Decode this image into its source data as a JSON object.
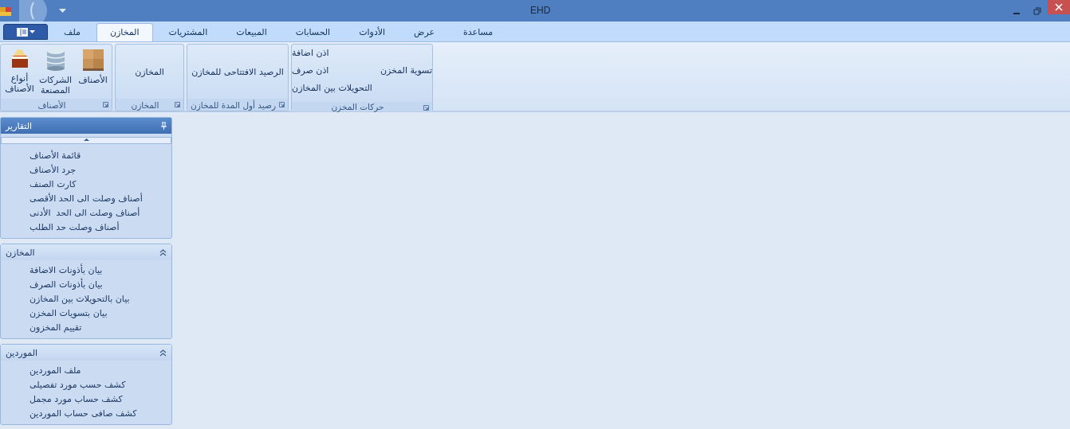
{
  "window": {
    "title": "EHD"
  },
  "tabs": [
    {
      "label": "مساعدة",
      "selected": false
    },
    {
      "label": "عرض",
      "selected": false
    },
    {
      "label": "الأدوات",
      "selected": false
    },
    {
      "label": "الحسابات",
      "selected": false
    },
    {
      "label": "المبيعات",
      "selected": false
    },
    {
      "label": "المشتريات",
      "selected": false
    },
    {
      "label": "المخازن",
      "selected": true
    },
    {
      "label": "ملف",
      "selected": false
    }
  ],
  "ribbon": {
    "groups": [
      {
        "kind": "columns",
        "label": "حركات المخزن",
        "columns": [
          [
            "تسوية المخزن"
          ],
          [
            "اذن اضافة",
            "اذن صرف",
            "التحويلات بين المخازن"
          ]
        ]
      },
      {
        "kind": "text",
        "label": "رصيد أول المدة للمخازن",
        "buttons": [
          "الرصيد الافتتاحى للمخازن"
        ]
      },
      {
        "kind": "text",
        "label": "المخازن",
        "buttons": [
          "المخازن"
        ]
      },
      {
        "kind": "icons",
        "label": "الأصناف",
        "buttons": [
          "الأصناف",
          "الشركات\nالمصنعة",
          "أنواع\nالأصناف"
        ]
      }
    ]
  },
  "sidebar": {
    "panels": [
      {
        "title": "التقارير",
        "expanded": true,
        "kind": "pinned",
        "items": [
          "قائمة الأصناف",
          "جرد الأصناف",
          "كارت الصنف",
          "أصناف وصلت الى الحد الأقصى",
          "أصناف وصلت الى الحد  الأدنى",
          "أصناف وصلت حد الطلب"
        ]
      },
      {
        "title": "المخازن",
        "expanded": true,
        "kind": "collapsible",
        "items": [
          "بيان بأذونات الاضافة",
          "بيان بأذونات الصرف",
          "بيان بالتحويلات بين المخازن",
          "بيان بتسويات المخزن",
          "تقييم المخزون"
        ]
      },
      {
        "title": "الموردين",
        "expanded": true,
        "kind": "collapsible",
        "items": [
          "ملف الموردين",
          "كشف حسب مورد تفصيلى",
          "كشف حساب مورد مجمل",
          "كشف صافى حساب الموردين"
        ]
      }
    ]
  }
}
